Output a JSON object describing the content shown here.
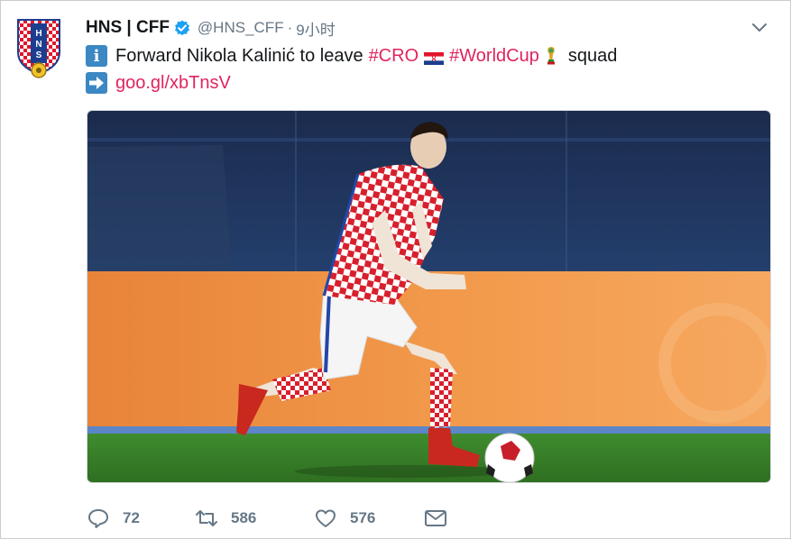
{
  "tweet": {
    "display_name": "HNS | CFF",
    "handle": "@HNS_CFF",
    "separator": "·",
    "time": "9小时",
    "text_main": "Forward Nikola Kalinić to leave",
    "hashtag1": "#CRO",
    "hashtag2": "#WorldCup",
    "text_end": "squad",
    "info_icon_char": "i",
    "link": "goo.gl/xbTnsV"
  },
  "logo_text": "HNS",
  "media": {
    "description_icon": "croatia-player-photo"
  },
  "actions": {
    "replies": "72",
    "retweets": "586",
    "likes": "576"
  },
  "colors": {
    "accent": "#e0245e",
    "muted": "#657786",
    "verified": "#1da1f2",
    "info_emoji": "#3b88c3",
    "arrow_emoji": "#3b88c3"
  },
  "icons": {
    "verified": "verified-badge-icon",
    "caret": "chevron-down-icon",
    "info": "information-emoji-icon",
    "arrow": "right-arrow-emoji-icon",
    "flag": "croatia-flag-icon",
    "cup": "world-cup-trophy-icon",
    "reply": "reply-icon",
    "retweet": "retweet-icon",
    "like": "heart-icon",
    "message": "direct-message-icon"
  }
}
